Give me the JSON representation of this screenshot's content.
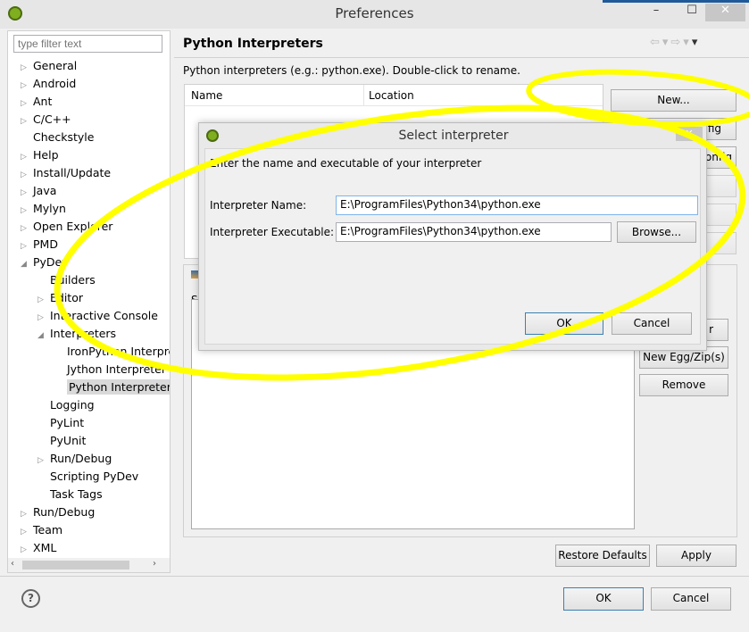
{
  "window": {
    "title": "Preferences",
    "minimize": "–",
    "maximize": "☐",
    "close": "✕"
  },
  "filter": {
    "placeholder": "type filter text"
  },
  "tree": [
    {
      "label": "General",
      "level": 0,
      "arrow": "▷"
    },
    {
      "label": "Android",
      "level": 0,
      "arrow": "▷"
    },
    {
      "label": "Ant",
      "level": 0,
      "arrow": "▷"
    },
    {
      "label": "C/C++",
      "level": 0,
      "arrow": "▷"
    },
    {
      "label": "Checkstyle",
      "level": 0,
      "arrow": ""
    },
    {
      "label": "Help",
      "level": 0,
      "arrow": "▷"
    },
    {
      "label": "Install/Update",
      "level": 0,
      "arrow": "▷"
    },
    {
      "label": "Java",
      "level": 0,
      "arrow": "▷"
    },
    {
      "label": "Mylyn",
      "level": 0,
      "arrow": "▷"
    },
    {
      "label": "Open Explorer",
      "level": 0,
      "arrow": "▷"
    },
    {
      "label": "PMD",
      "level": 0,
      "arrow": "▷"
    },
    {
      "label": "PyDev",
      "level": 0,
      "arrow": "◢"
    },
    {
      "label": "Builders",
      "level": 1,
      "arrow": ""
    },
    {
      "label": "Editor",
      "level": 1,
      "arrow": "▷"
    },
    {
      "label": "Interactive Console",
      "level": 1,
      "arrow": "▷"
    },
    {
      "label": "Interpreters",
      "level": 1,
      "arrow": "◢"
    },
    {
      "label": "IronPython Interpreter",
      "level": 2,
      "arrow": ""
    },
    {
      "label": "Jython Interpreter",
      "level": 2,
      "arrow": ""
    },
    {
      "label": "Python Interpreter",
      "level": 2,
      "arrow": "",
      "selected": true
    },
    {
      "label": "Logging",
      "level": 1,
      "arrow": ""
    },
    {
      "label": "PyLint",
      "level": 1,
      "arrow": ""
    },
    {
      "label": "PyUnit",
      "level": 1,
      "arrow": ""
    },
    {
      "label": "Run/Debug",
      "level": 1,
      "arrow": "▷"
    },
    {
      "label": "Scripting PyDev",
      "level": 1,
      "arrow": ""
    },
    {
      "label": "Task Tags",
      "level": 1,
      "arrow": ""
    },
    {
      "label": "Run/Debug",
      "level": 0,
      "arrow": "▷"
    },
    {
      "label": "Team",
      "level": 0,
      "arrow": "▷"
    },
    {
      "label": "XML",
      "level": 0,
      "arrow": "▷"
    }
  ],
  "page": {
    "title": "Python Interpreters",
    "description": "Python interpreters (e.g.: python.exe).   Double-click to rename.",
    "columns": [
      "Name",
      "Location"
    ],
    "buttons": {
      "new": "New...",
      "quick_config": "fig",
      "config": "onfig",
      "partial": "r",
      "new_egg": "New Egg/Zip(s)",
      "remove": "Remove"
    },
    "lower_label": "S",
    "restore": "Restore Defaults",
    "apply": "Apply"
  },
  "footer": {
    "help": "?",
    "ok": "OK",
    "cancel": "Cancel"
  },
  "dialog": {
    "title": "Select interpreter",
    "message": "Enter the name and executable of your interpreter",
    "name_label": "Interpreter Name:",
    "name_value": "E:\\ProgramFiles\\Python34\\python.exe",
    "exec_label": "Interpreter Executable:",
    "exec_value": "E:\\ProgramFiles\\Python34\\python.exe",
    "browse": "Browse...",
    "ok": "OK",
    "cancel": "Cancel",
    "close": "✕"
  },
  "colors": {
    "highlight": "#ffff00",
    "selection": "#d9d9d9"
  }
}
